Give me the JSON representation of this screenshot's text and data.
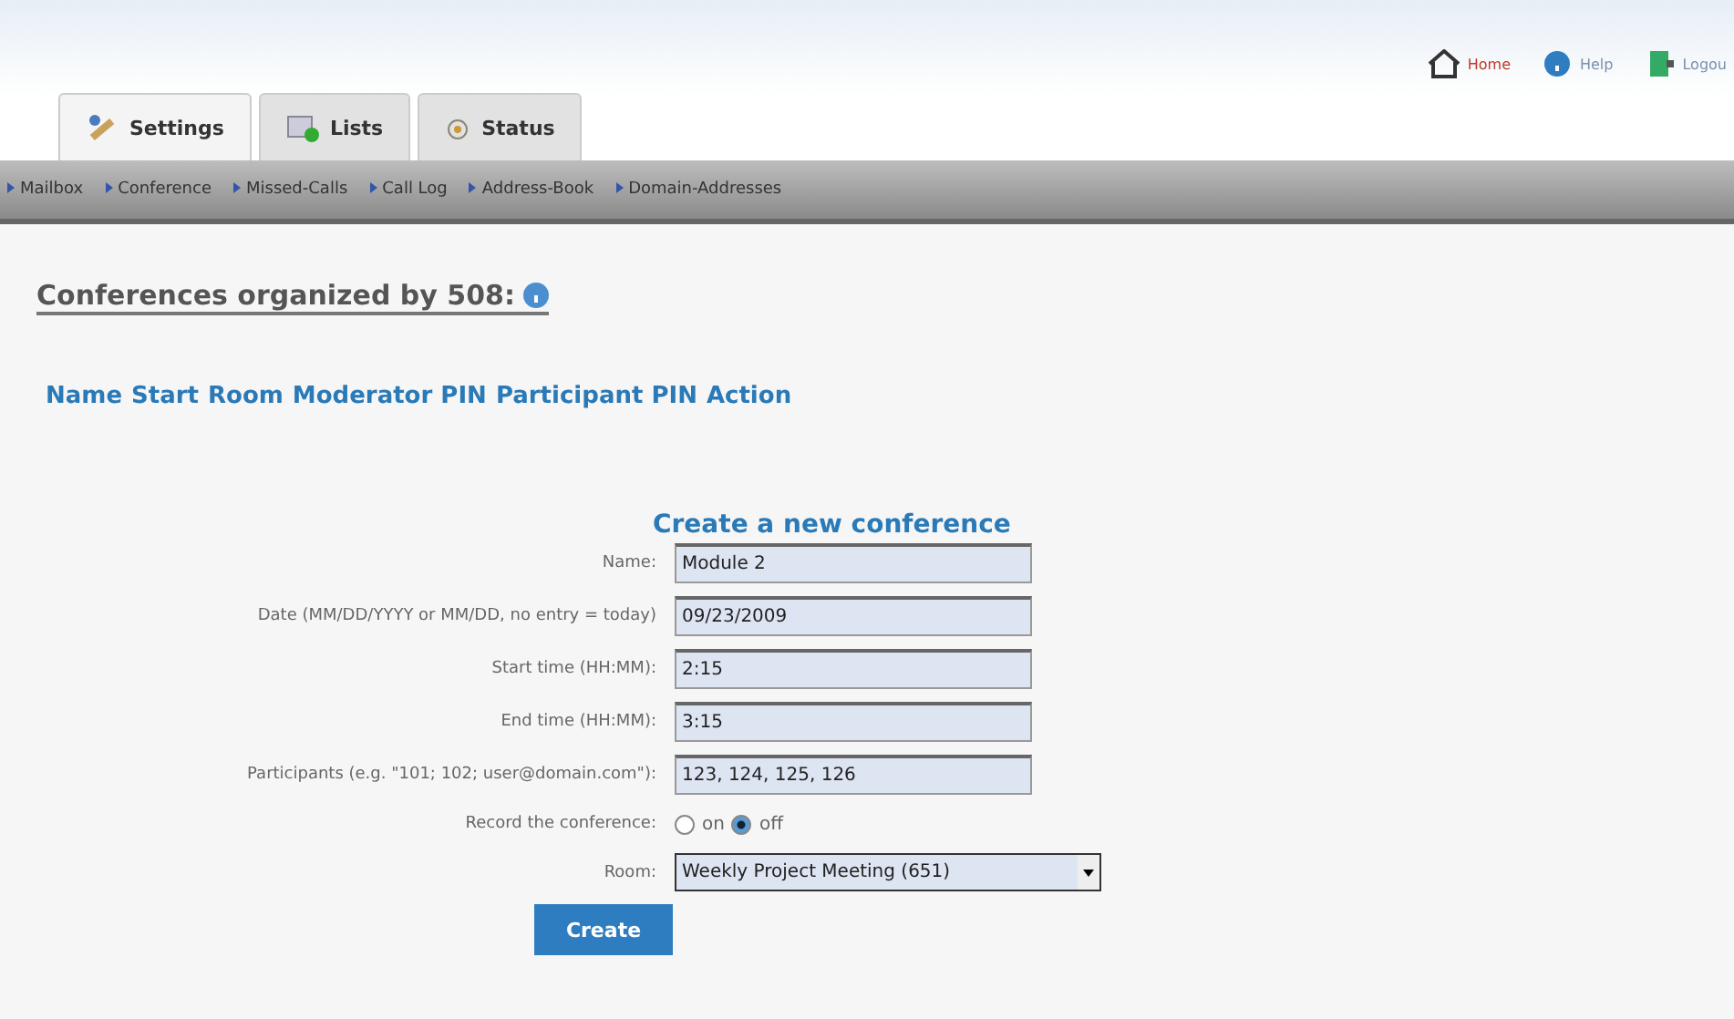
{
  "top_links": [
    {
      "kind": "home",
      "label": "Home"
    },
    {
      "kind": "help",
      "label": "Help"
    },
    {
      "kind": "logout",
      "label": "Logou"
    }
  ],
  "tabs": [
    {
      "kind": "settings",
      "label": "Settings",
      "selected": true
    },
    {
      "kind": "lists",
      "label": "Lists",
      "selected": false
    },
    {
      "kind": "status",
      "label": "Status",
      "selected": false
    }
  ],
  "nav": [
    "Mailbox",
    "Conference",
    "Missed-Calls",
    "Call Log",
    "Address-Book",
    "Domain-Addresses"
  ],
  "heading": "Conferences organized by 508:",
  "table": {
    "columns": [
      "Name",
      "Start",
      "Room",
      "Moderator PIN",
      "Participant PIN",
      "Action"
    ]
  },
  "form": {
    "title": "Create a new conference",
    "fields": [
      {
        "kind": "text",
        "label": "Name:",
        "value": "Module 2"
      },
      {
        "kind": "text",
        "label": "Date (MM/DD/YYYY or MM/DD, no entry = today)",
        "value": "09/23/2009"
      },
      {
        "kind": "text",
        "label": "Start time (HH:MM):",
        "value": "2:15"
      },
      {
        "kind": "text",
        "label": "End time (HH:MM):",
        "value": "3:15"
      },
      {
        "kind": "text",
        "label": "Participants (e.g. \"101; 102; user@domain.com\"):",
        "value": "123, 124, 125, 126"
      },
      {
        "kind": "radio",
        "label": "Record the conference:",
        "options": [
          {
            "label": "on",
            "selected": false
          },
          {
            "label": "off",
            "selected": true
          }
        ]
      },
      {
        "kind": "select",
        "label": "Room:",
        "value": "Weekly Project Meeting (651)"
      }
    ],
    "button": "Create"
  }
}
